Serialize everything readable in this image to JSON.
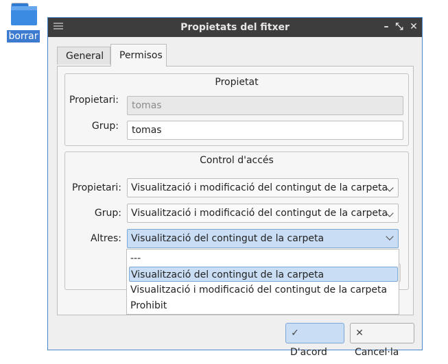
{
  "desktop": {
    "icon_label": "borrar"
  },
  "window": {
    "title": "Propietats del fitxer"
  },
  "tabs": [
    {
      "label": "General"
    },
    {
      "label": "Permisos"
    }
  ],
  "ownership": {
    "title": "Propietat",
    "owner_label": "Propietari:",
    "owner_value": "tomas",
    "group_label": "Grup:",
    "group_value": "tomas"
  },
  "access": {
    "title": "Control d'accés",
    "owner_label": "Propietari:",
    "owner_value": "Visualització i modificació del contingut de la carpeta",
    "group_label": "Grup:",
    "group_value": "Visualització i modificació del contingut de la carpeta",
    "others_label": "Altres:",
    "others_value": "Visualització del contingut de la carpeta",
    "options": [
      "---",
      "Visualització del contingut de la carpeta",
      "Visualització i modificació del contingut de la carpeta",
      "Prohibit"
    ]
  },
  "buttons": {
    "ok": "D'acord",
    "cancel": "Cancel·la"
  },
  "colors": {
    "selection": "#c9ddf4",
    "titlebar": "#3d3d3d",
    "accent": "#3c7bd0"
  }
}
